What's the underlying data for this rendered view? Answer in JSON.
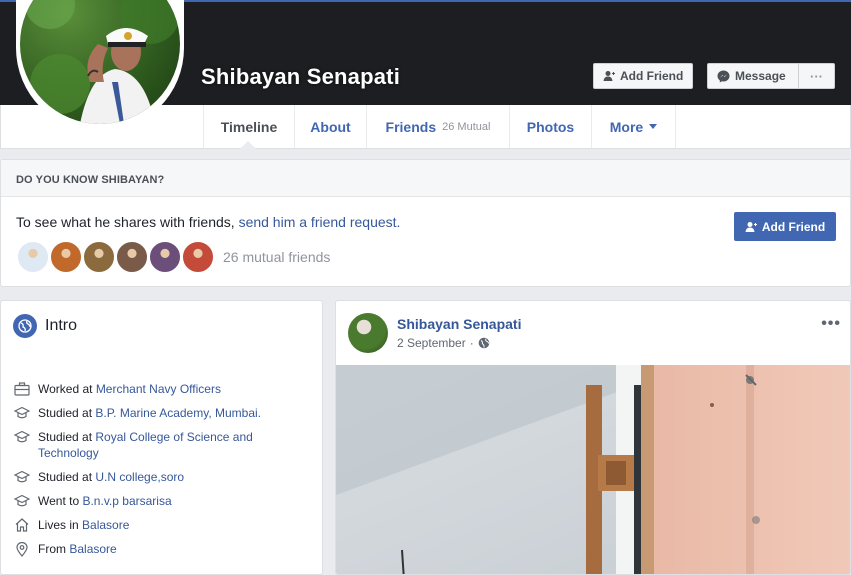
{
  "profile": {
    "name": "Shibayan Senapati",
    "add_friend_label": "Add Friend",
    "message_label": "Message",
    "more_dots": "···"
  },
  "nav": {
    "tabs": [
      {
        "label": "Timeline"
      },
      {
        "label": "About"
      },
      {
        "label": "Friends",
        "sub": "26 Mutual"
      },
      {
        "label": "Photos"
      },
      {
        "label": "More"
      }
    ]
  },
  "know": {
    "heading": "DO YOU KNOW SHIBAYAN?",
    "text": "To see what he shares with friends, ",
    "link": "send him a friend request.",
    "button": "Add Friend",
    "mutual_count": "26 mutual friends",
    "mutual_colors": [
      "#dfe9f3",
      "#c0692b",
      "#8b6b3d",
      "#7a5a48",
      "#6b4f7a",
      "#c44a3a",
      "#9aa6b2"
    ]
  },
  "intro": {
    "title": "Intro",
    "items": [
      {
        "icon": "briefcase-icon",
        "prefix": "Worked at ",
        "link": "Merchant Navy Officers",
        "suffix": ""
      },
      {
        "icon": "graduation-cap-icon",
        "prefix": "Studied at ",
        "link": "B.P. Marine Academy, Mumbai.",
        "suffix": ""
      },
      {
        "icon": "graduation-cap-icon",
        "prefix": "Studied at ",
        "link": "Royal College of Science and Technology",
        "suffix": ""
      },
      {
        "icon": "graduation-cap-icon",
        "prefix": "Studied at ",
        "link": "U.N college,soro",
        "suffix": ""
      },
      {
        "icon": "graduation-cap-icon",
        "prefix": "Went to ",
        "link": "B.n.v.p barsarisa",
        "suffix": ""
      },
      {
        "icon": "home-icon",
        "prefix": "Lives in ",
        "link": "Balasore",
        "suffix": ""
      },
      {
        "icon": "location-pin-icon",
        "prefix": "From ",
        "link": "Balasore",
        "suffix": ""
      }
    ]
  },
  "post": {
    "author": "Shibayan Senapati",
    "time": "2 September",
    "separator": "·",
    "menu": "•••"
  },
  "colors": {
    "brand": "#4267b2",
    "link": "#365899",
    "cover": "#1c1e21"
  }
}
